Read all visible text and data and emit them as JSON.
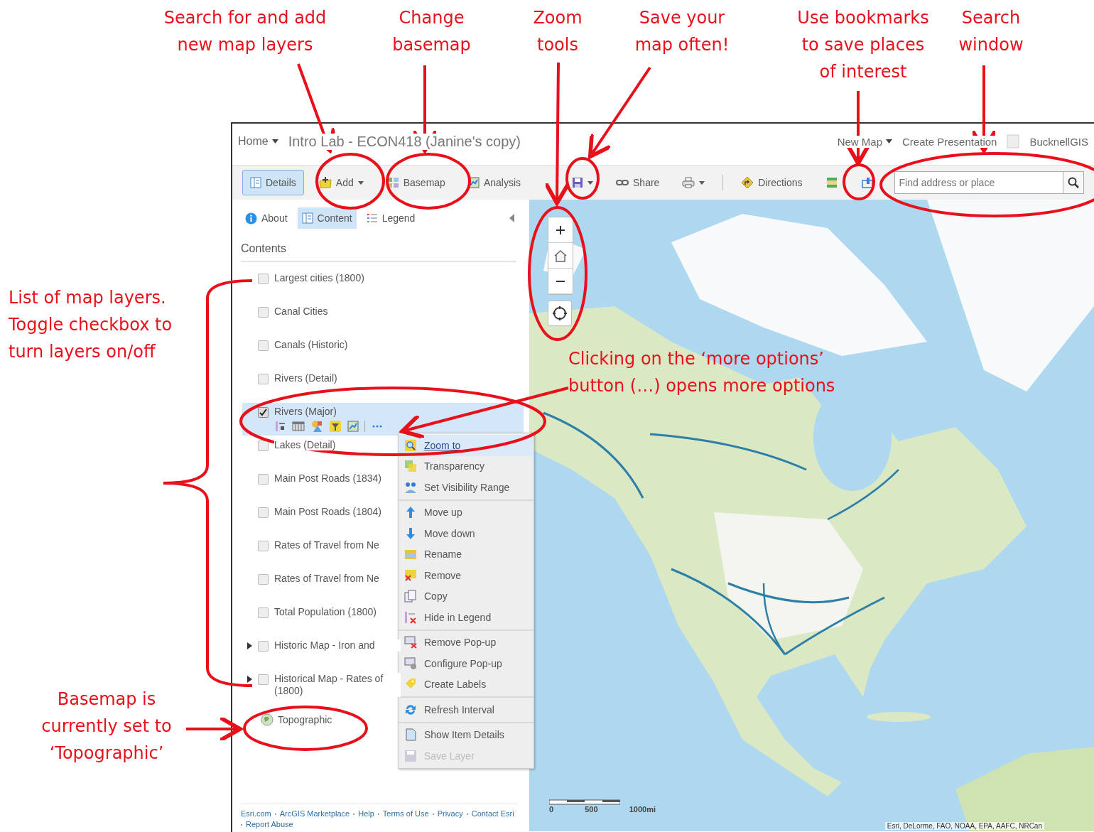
{
  "header": {
    "home": "Home",
    "title": "Intro Lab - ECON418 (Janine's copy)",
    "links": [
      "New Map",
      "Create Presentation"
    ],
    "user": "BucknellGIS"
  },
  "toolbar": [
    {
      "kind": "details",
      "label": "Details",
      "selected": true
    },
    {
      "kind": "add",
      "label": "Add",
      "selected": false
    },
    {
      "kind": "basemap",
      "label": "Basemap",
      "selected": false
    },
    {
      "kind": "analysis",
      "label": "Analysis",
      "selected": false
    },
    {
      "kind": "save",
      "selected": false
    },
    {
      "kind": "share",
      "label": "Share",
      "selected": false
    },
    {
      "kind": "print",
      "selected": false
    },
    {
      "kind": "directions",
      "label": "Directions",
      "selected": false
    },
    {
      "kind": "measure",
      "selected": false
    },
    {
      "kind": "bookmarks",
      "selected": false
    }
  ],
  "search": {
    "placeholder": "Find address or place"
  },
  "panel": {
    "tabs": [
      {
        "kind": "about",
        "label": "About",
        "selected": false
      },
      {
        "kind": "content",
        "label": "Content",
        "selected": true
      },
      {
        "kind": "legend",
        "label": "Legend",
        "selected": false
      }
    ],
    "heading": "Contents",
    "layers": [
      {
        "kind": "layer",
        "label": "Largest cities (1800)",
        "checked": false,
        "selected": false
      },
      {
        "kind": "layer",
        "label": "Canal Cities",
        "checked": false,
        "selected": false
      },
      {
        "kind": "layer",
        "label": "Canals (Historic)",
        "checked": false,
        "selected": false
      },
      {
        "kind": "layer",
        "label": "Rivers (Detail)",
        "checked": false,
        "selected": false
      },
      {
        "kind": "layer",
        "label": "Rivers (Major)",
        "checked": true,
        "selected": true
      },
      {
        "kind": "layer",
        "label": "Lakes (Detail)",
        "checked": false,
        "selected": false
      },
      {
        "kind": "layer",
        "label": "Main Post Roads (1834)",
        "checked": false,
        "selected": false
      },
      {
        "kind": "layer",
        "label": "Main Post Roads (1804)",
        "checked": false,
        "selected": false
      },
      {
        "kind": "layer",
        "label": "Rates of Travel from Ne",
        "checked": false,
        "selected": false
      },
      {
        "kind": "layer",
        "label": "Rates of Travel from Ne",
        "checked": false,
        "selected": false
      },
      {
        "kind": "layer",
        "label": "Total Population (1800)",
        "checked": false,
        "selected": false
      },
      {
        "kind": "group",
        "label": "Historic Map - Iron and",
        "checked": false,
        "selected": false
      },
      {
        "kind": "group",
        "label": "Historical Map - Rates of (1800)",
        "checked": false,
        "selected": false
      }
    ],
    "basemap": "Topographic",
    "footer_links": [
      "Esri.com",
      "ArcGIS Marketplace",
      "Help",
      "Terms of Use",
      "Privacy",
      "Contact Esri",
      "Report Abuse"
    ]
  },
  "menu": [
    [
      {
        "label": "Zoom to",
        "selected": true,
        "disabled": false
      },
      {
        "label": "Transparency",
        "selected": false,
        "disabled": false
      },
      {
        "label": "Set Visibility Range",
        "selected": false,
        "disabled": false
      }
    ],
    [
      {
        "label": "Move up",
        "selected": false,
        "disabled": false
      },
      {
        "label": "Move down",
        "selected": false,
        "disabled": false
      },
      {
        "label": "Rename",
        "selected": false,
        "disabled": false
      },
      {
        "label": "Remove",
        "selected": false,
        "disabled": false
      },
      {
        "label": "Copy",
        "selected": false,
        "disabled": false
      },
      {
        "label": "Hide in Legend",
        "selected": false,
        "disabled": false
      }
    ],
    [
      {
        "label": "Remove Pop-up",
        "selected": false,
        "disabled": false
      },
      {
        "label": "Configure Pop-up",
        "selected": false,
        "disabled": false
      },
      {
        "label": "Create Labels",
        "selected": false,
        "disabled": false
      }
    ],
    [
      {
        "label": "Refresh Interval",
        "selected": false,
        "disabled": false
      }
    ],
    [
      {
        "label": "Show Item Details",
        "selected": false,
        "disabled": false
      },
      {
        "label": "Save Layer",
        "selected": false,
        "disabled": true
      }
    ]
  ],
  "map": {
    "kind": "picture",
    "scale_labels": [
      "0",
      "500",
      "1000mi"
    ],
    "attribution": "Esri, DeLorme, FAO, NOAA, EPA, AAFC, NRCan"
  },
  "annotations": [
    {
      "lines": [
        "Search for and add",
        "new map layers"
      ]
    },
    {
      "lines": [
        "Change",
        "basemap"
      ]
    },
    {
      "lines": [
        "Zoom",
        "tools"
      ]
    },
    {
      "lines": [
        "Save your",
        "map often!"
      ]
    },
    {
      "lines": [
        "Use bookmarks",
        "to save places",
        "of interest"
      ]
    },
    {
      "lines": [
        "Search",
        "window"
      ]
    },
    {
      "lines": [
        "List of map layers.",
        "Toggle checkbox to",
        "turn layers on/off"
      ]
    },
    {
      "lines": [
        "Basemap is",
        "currently set to",
        "‘Topographic’"
      ]
    },
    {
      "lines": [
        "Clicking on the ‘more options’",
        "button (…) opens more options"
      ]
    }
  ]
}
